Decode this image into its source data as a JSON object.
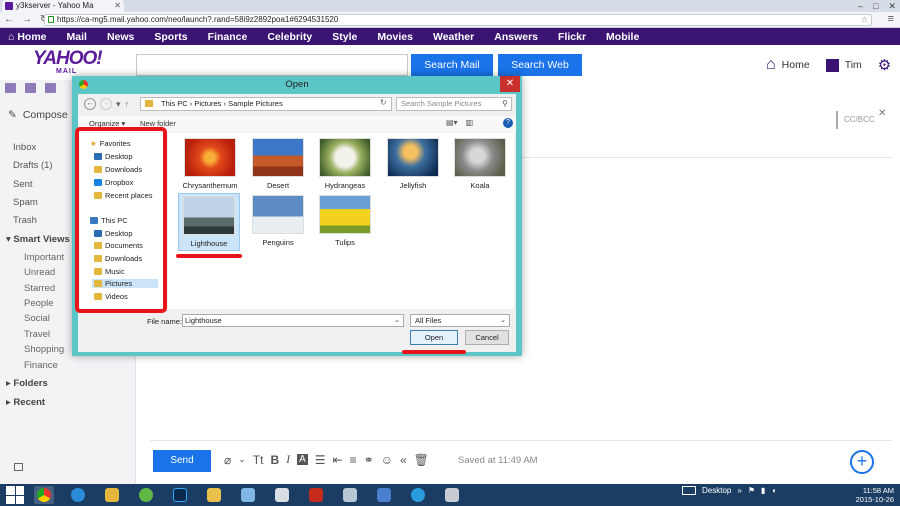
{
  "browser": {
    "tab_title": "y3kserver - Yahoo Ma",
    "url": "https://ca-mg5.mail.yahoo.com/neo/launch?.rand=58i9z2892poa1#6294531520"
  },
  "yahoo_nav": [
    "Home",
    "Mail",
    "News",
    "Sports",
    "Finance",
    "Celebrity",
    "Style",
    "Movies",
    "Weather",
    "Answers",
    "Flickr",
    "Mobile"
  ],
  "header": {
    "logo": "YAHOO!",
    "logo_sub": "MAIL",
    "search_mail": "Search Mail",
    "search_web": "Search Web",
    "home": "Home",
    "user": "Tim"
  },
  "sidebar": {
    "compose": "Compose",
    "folders": [
      "Inbox",
      "Drafts (1)",
      "Sent",
      "Spam",
      "Trash"
    ],
    "smart_views_label": "Smart Views",
    "smart_views": [
      "Important",
      "Unread",
      "Starred",
      "People",
      "Social",
      "Travel",
      "Shopping",
      "Finance"
    ],
    "folders_label": "Folders",
    "recent_label": "Recent"
  },
  "compose": {
    "cc_bcc": "CC/BCC",
    "send": "Send",
    "saved": "Saved at 11:49 AM",
    "format_tt": "Tt",
    "format_b": "B",
    "format_i": "I",
    "format_a": "A"
  },
  "dialog": {
    "title": "Open",
    "breadcrumb": "This PC  ›  Pictures  ›  Sample Pictures",
    "search_placeholder": "Search Sample Pictures",
    "organize": "Organize ▾",
    "new_folder": "New folder",
    "nav": {
      "favorites": "Favorites",
      "fav_items": [
        "Desktop",
        "Downloads",
        "Dropbox",
        "Recent places"
      ],
      "this_pc": "This PC",
      "pc_items": [
        "Desktop",
        "Documents",
        "Downloads",
        "Music",
        "Pictures",
        "Videos"
      ]
    },
    "files": [
      "Chrysanthemum",
      "Desert",
      "Hydrangeas",
      "Jellyfish",
      "Koala",
      "Lighthouse",
      "Penguins",
      "Tulips"
    ],
    "file_name_label": "File name:",
    "file_name_value": "Lighthouse",
    "file_type": "All Files",
    "open_btn": "Open",
    "cancel_btn": "Cancel"
  },
  "taskbar": {
    "desktop_label": "Desktop",
    "time": "11:58 AM",
    "date": "2015-10-26"
  },
  "colors": {
    "yahoo_purple": "#3b1473",
    "accent_blue": "#1a73e8",
    "dialog_frame": "#5ac6c8",
    "annotation_red": "#e8141b",
    "taskbar": "#1c3d63"
  }
}
